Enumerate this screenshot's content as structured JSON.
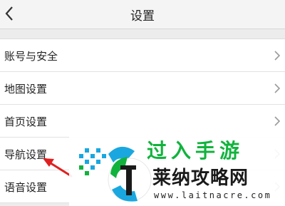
{
  "header": {
    "title": "设置",
    "back_icon": "chevron-left-icon"
  },
  "settings": {
    "items": [
      {
        "label": "账号与安全",
        "icon": "chevron-right-icon"
      },
      {
        "label": "地图设置",
        "icon": "chevron-right-icon"
      },
      {
        "label": "首页设置",
        "icon": "chevron-right-icon"
      },
      {
        "label": "导航设置",
        "icon": "chevron-right-icon"
      },
      {
        "label": "语音设置",
        "icon": "chevron-right-icon"
      }
    ]
  },
  "watermark": {
    "top_text": "过入手游",
    "brand": "莱纳攻略网",
    "url": "www.laitnacre.com",
    "accent": "#11b33d"
  },
  "colors": {
    "arrow": "#e02020",
    "accent": "#1aa7df"
  }
}
